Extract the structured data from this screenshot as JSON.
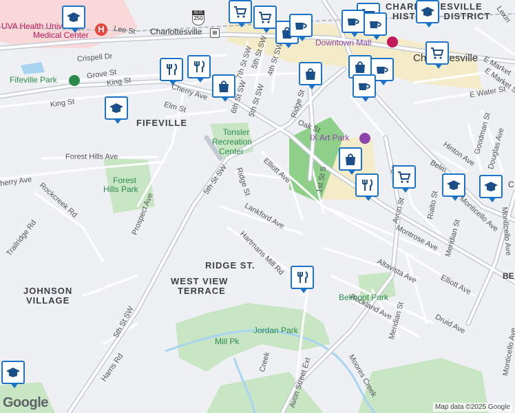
{
  "streets": {
    "lee_st": "Lee St",
    "charlottesville_station": "Charlottesville",
    "route_250": "250",
    "bus": "BUS",
    "crispell_dr": "Crispell Dr",
    "grove_st": "Grove St",
    "king_st_1": "King St",
    "king_st_2": "King St",
    "cherry_ave_1": "Cherry Ave",
    "cherry_ave_2": "herry Ave",
    "elm_st": "Elm St",
    "seventh_st_sw": "7th St SW",
    "sixth_st_sw": "6th St SW",
    "fifth_st_sw_top": "5th St SW",
    "fifth_st_sw_mid": "5th St SW",
    "fifth_st_sw_bottom": "5th St SW",
    "fourth_st_sw": "4th St SW",
    "ridge_st_top": "Ridge St",
    "ridge_st_mid": "Ridge St",
    "oak_st": "Oak St",
    "forest_hills_ave": "Forest Hills Ave",
    "rockcreek_rd": "Rockcreek Rd",
    "trailridge_rd": "Trailridge Rd",
    "prospect_ave": "Prospect Ave",
    "elliott_ave_1": "Elliott Ave",
    "elliott_ave_2": "Elliott Ave",
    "lankford_ave": "Lankford Ave",
    "hartmans_mill_rd": "Hartmans Mill Rd",
    "first_st_s": "1st St S",
    "avon_st": "Avon St",
    "avon_street_ext": "Avon Street Ext",
    "montrose_ave": "Montrose Ave",
    "altavista_ave": "Altavista Ave",
    "rockland_ave": "Rockland Ave",
    "meridian_st_1": "Meridian St",
    "meridian_st_2": "Meridian St",
    "druid_ave": "Druid Ave",
    "monticello_ave_1": "Monticello Ave",
    "monticello_ave_2": "Monticello Ave",
    "monticello_ave_3": "Monticello Ave",
    "rialto_st": "Rialto St",
    "hinton_ave": "Hinton Ave",
    "goodman_st": "Goodman St",
    "douglas_ave": "Douglas Ave",
    "e_market_st": "E Market St",
    "e_water_st": "E Water St",
    "e_market_lbl": "E Market",
    "lexington": "Lexin",
    "belm": "Belm",
    "se": "SE",
    "moores_creek": "Moores Creek",
    "creek": "Creek",
    "harris_rd": "Harris Rd",
    "be": "BE",
    "c_partial": "C"
  },
  "neighborhoods": {
    "fifeville": "FIFEVILLE",
    "ridge_st": "RIDGE ST.",
    "west_view_terrace_1": "WEST VIEW",
    "west_view_terrace_2": "TERRACE",
    "johnson_village_1": "JOHNSON",
    "johnson_village_2": "VILLAGE",
    "historic_district_1": "CHARLOTTESVILLE",
    "historic_district_2": "HISTORIC DISTRICT"
  },
  "places": {
    "uva_health_1": "UVA Health University",
    "uva_health_2": "Medical Center",
    "fifeville_park": "Fifeville Park",
    "tonsler_1": "Tonsler",
    "tonsler_2": "Recreation",
    "tonsler_3": "Center",
    "forest_hills_park_1": "Forest",
    "forest_hills_park_2": "Hills Park",
    "ix_art_park": "IX Art Park",
    "downtown_mall": "Downtown Mall",
    "belmont_park": "Belmont Park",
    "jordan_park": "Jordan Park",
    "mill_pk": "Mill Pk",
    "city_label": "Charlottesville"
  },
  "icons": {
    "school": "school-icon",
    "shop": "shopping-bag-icon",
    "restaurant": "restaurant-icon",
    "cafe": "cafe-icon",
    "grocery": "grocery-cart-icon"
  },
  "attribution": {
    "logo": "Google",
    "map_data": "Map data ©2025 Google"
  },
  "colors": {
    "pin_border": "#1a73c8",
    "park": "#c9e6c4",
    "water": "#a8d4f2",
    "road": "#ffffff",
    "highway": "#c3cad3",
    "downtown": "#f4ebc9",
    "hospital": "#f8d8d8"
  }
}
